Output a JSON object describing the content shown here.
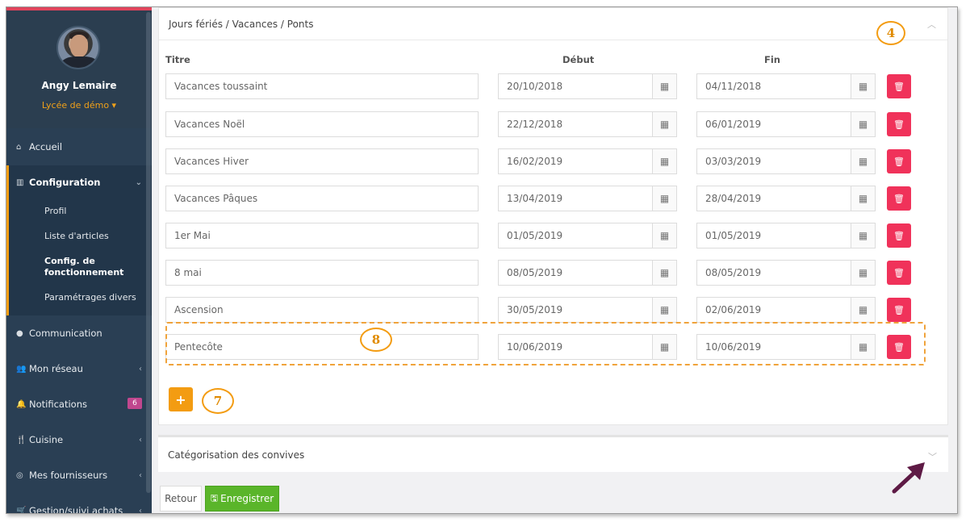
{
  "sidebar": {
    "user_name": "Angy Lemaire",
    "school": "Lycée de démo ▾",
    "items": [
      {
        "label": "Accueil",
        "icon": "home-icon"
      },
      {
        "label": "Configuration",
        "icon": "bank-icon"
      },
      {
        "label": "Communication",
        "icon": "chat-icon"
      },
      {
        "label": "Mon réseau",
        "icon": "users-icon"
      },
      {
        "label": "Notifications",
        "icon": "bell-icon",
        "badge": "6"
      },
      {
        "label": "Cuisine",
        "icon": "cutlery-icon"
      },
      {
        "label": "Mes fournisseurs",
        "icon": "handshake-icon"
      },
      {
        "label": "Gestion/suivi achats",
        "icon": "cart-icon"
      }
    ],
    "submenu": [
      "Profil",
      "Liste d'articles",
      "Config. de fonctionnement",
      "Paramétrages divers"
    ]
  },
  "panel1": {
    "title": "Jours fériés / Vacances / Ponts",
    "columns": {
      "title": "Titre",
      "start": "Début",
      "end": "Fin"
    },
    "rows": [
      {
        "title": "Vacances toussaint",
        "start": "20/10/2018",
        "end": "04/11/2018"
      },
      {
        "title": "Vacances Noël",
        "start": "22/12/2018",
        "end": "06/01/2019"
      },
      {
        "title": "Vacances Hiver",
        "start": "16/02/2019",
        "end": "03/03/2019"
      },
      {
        "title": "Vacances Pâques",
        "start": "13/04/2019",
        "end": "28/04/2019"
      },
      {
        "title": "1er Mai",
        "start": "01/05/2019",
        "end": "01/05/2019"
      },
      {
        "title": "8 mai",
        "start": "08/05/2019",
        "end": "08/05/2019"
      },
      {
        "title": "Ascension",
        "start": "30/05/2019",
        "end": "02/06/2019"
      },
      {
        "title": "Pentecôte",
        "start": "10/06/2019",
        "end": "10/06/2019"
      }
    ],
    "add_label": "+"
  },
  "panel2": {
    "title": "Catégorisation des convives"
  },
  "footer": {
    "back_label": "Retour",
    "save_label": "Enregistrer"
  },
  "annotations": {
    "callout_4": "4",
    "callout_7": "7",
    "callout_8": "8"
  },
  "colors": {
    "sidebar_bg": "#2a3f54",
    "accent_orange": "#f39c12",
    "delete_red": "#f0325a",
    "save_green": "#5ab52a"
  }
}
